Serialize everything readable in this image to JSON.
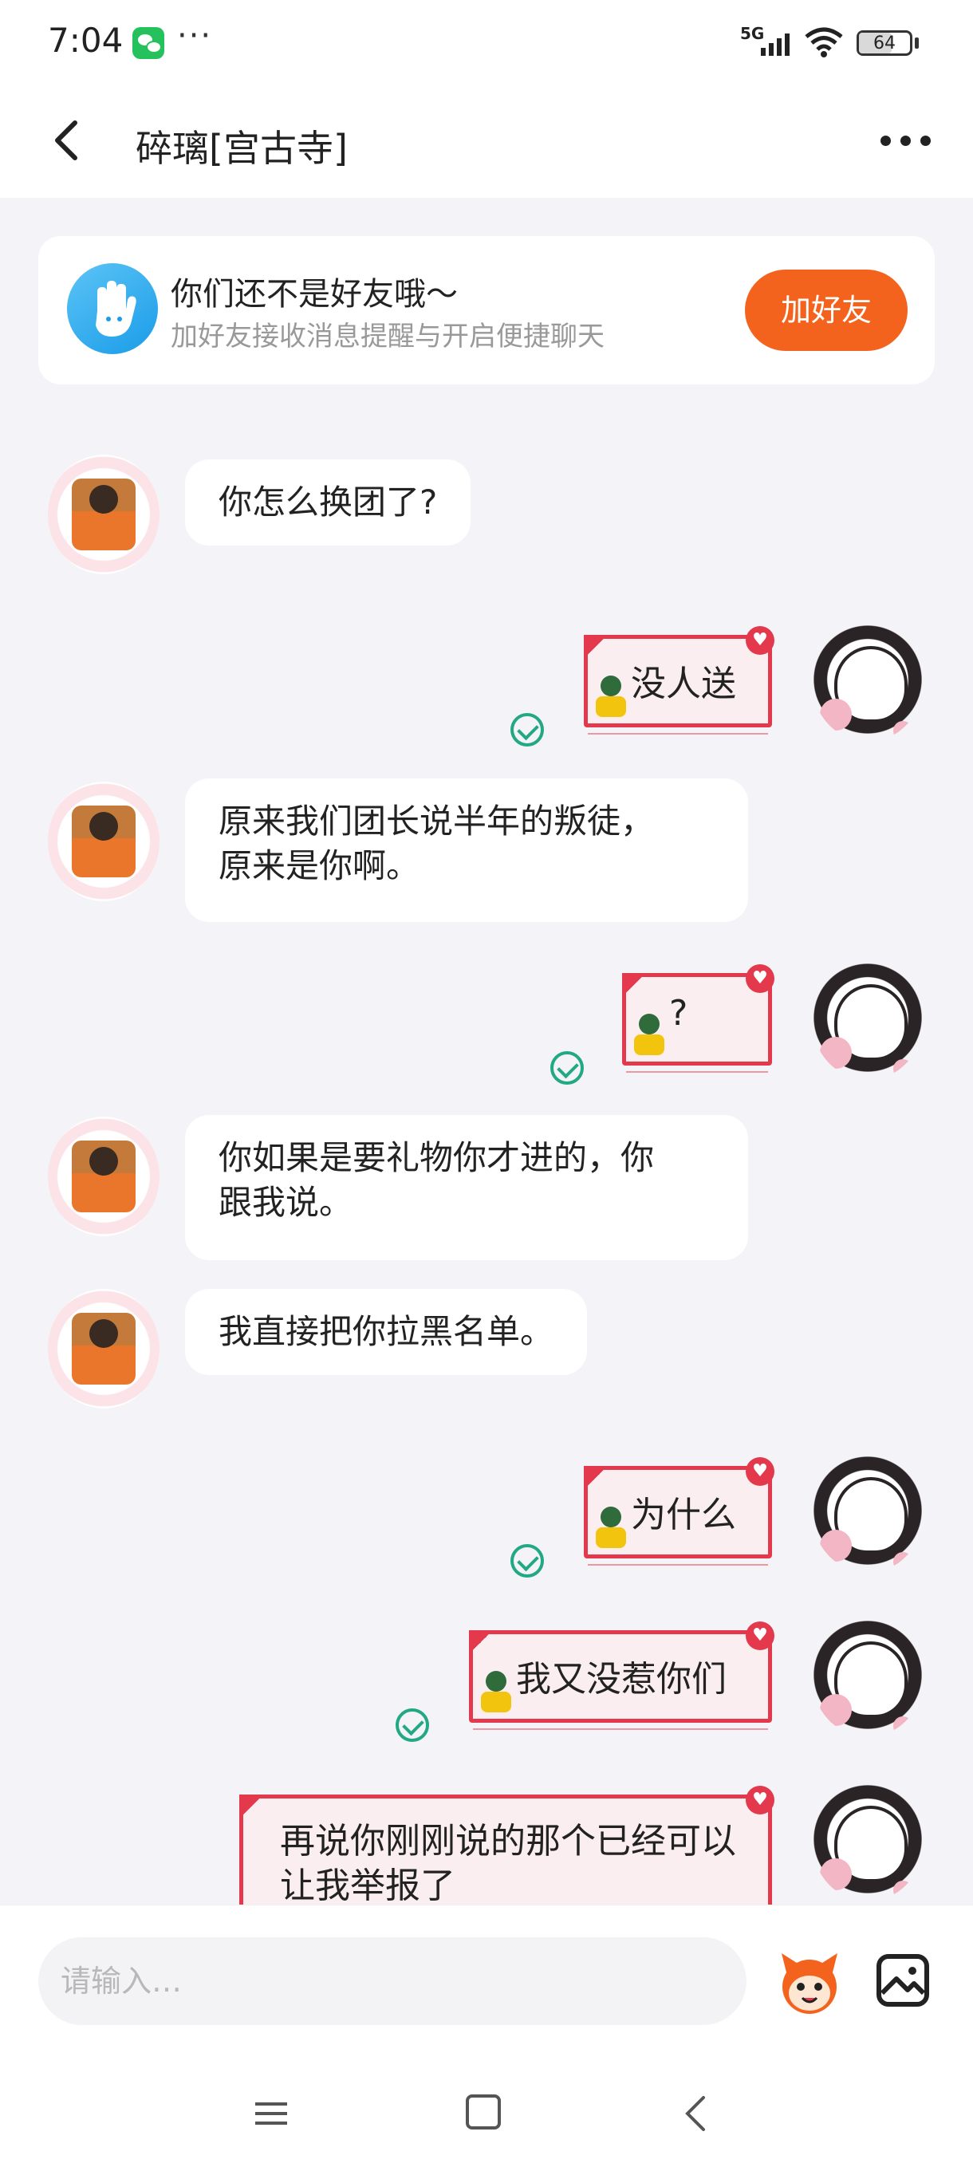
{
  "status_bar": {
    "time": "7:04",
    "more": "···",
    "network": "5G",
    "battery_level": "64",
    "battery_fraction": 0.64,
    "icons": [
      "wechat-icon",
      "signal-icon",
      "wifi-icon",
      "battery-icon"
    ]
  },
  "header": {
    "title": "碎璃[宫古寺]",
    "back_icon": "chevron-left-icon",
    "more_icon": "more-dots-icon"
  },
  "friend_banner": {
    "title": "你们还不是好友哦～",
    "subtitle": "加好友接收消息提醒与开启便捷聊天",
    "button_label": "加好友",
    "accent_color": "#f4631d",
    "icon": "hand-wave-icon"
  },
  "messages": [
    {
      "direction": "incoming",
      "text": "你怎么换团了?"
    },
    {
      "direction": "outgoing",
      "text": "没人送",
      "read": true
    },
    {
      "direction": "incoming",
      "text": "原来我们团长说半年的叛徒，\n原来是你啊。"
    },
    {
      "direction": "outgoing",
      "text": "?",
      "read": true
    },
    {
      "direction": "incoming",
      "text": "你如果是要礼物你才进的，你\n跟我说。"
    },
    {
      "direction": "incoming",
      "text": "我直接把你拉黑名单。"
    },
    {
      "direction": "outgoing",
      "text": "为什么",
      "read": true
    },
    {
      "direction": "outgoing",
      "text": "我又没惹你们",
      "read": true
    },
    {
      "direction": "outgoing",
      "text": "再说你刚刚说的那个已经可以让我举报了"
    }
  ],
  "input_bar": {
    "placeholder": "请输入…",
    "emoji_icon": "emoji-mascot-icon",
    "image_icon": "image-icon"
  },
  "nav_bar": {
    "icons": [
      "menu-icon",
      "home-square-icon",
      "back-chevron-icon"
    ]
  },
  "colors": {
    "accent_orange": "#f4631d",
    "bubble_border_red": "#e4394c",
    "read_check_green": "#22a884",
    "background": "#f4f4f8"
  }
}
